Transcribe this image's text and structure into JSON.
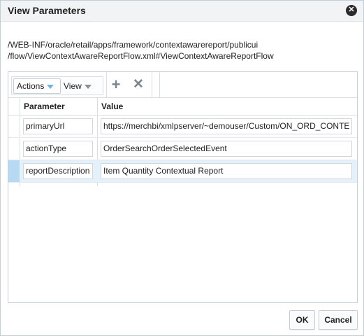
{
  "dialog": {
    "title": "View Parameters",
    "close_icon": "close-icon"
  },
  "path": {
    "line1": "/WEB-INF/oracle/retail/apps/framework/contextawarereport/publicui",
    "line2": "/flow/ViewContextAwareReportFlow.xml#ViewContextAwareReportFlow"
  },
  "toolbar": {
    "actions_label": "Actions",
    "view_label": "View",
    "add_icon": "plus-icon",
    "delete_icon": "x-icon"
  },
  "table": {
    "columns": [
      "Parameter",
      "Value"
    ],
    "rows": [
      {
        "parameter": "primaryUrl",
        "value": "https://merchbi/xmlpserver/~demouser/Custom/ON_ORD_CONTE",
        "selected": false
      },
      {
        "parameter": "actionType",
        "value": "OrderSearchOrderSelectedEvent",
        "selected": false
      },
      {
        "parameter": "reportDescription",
        "value": "Item Quantity Contextual Report",
        "selected": true
      }
    ]
  },
  "buttons": {
    "ok_label": "OK",
    "cancel_label": "Cancel"
  },
  "colors": {
    "accent": "#6ab4e8",
    "selected_row": "#e4f1fb"
  }
}
